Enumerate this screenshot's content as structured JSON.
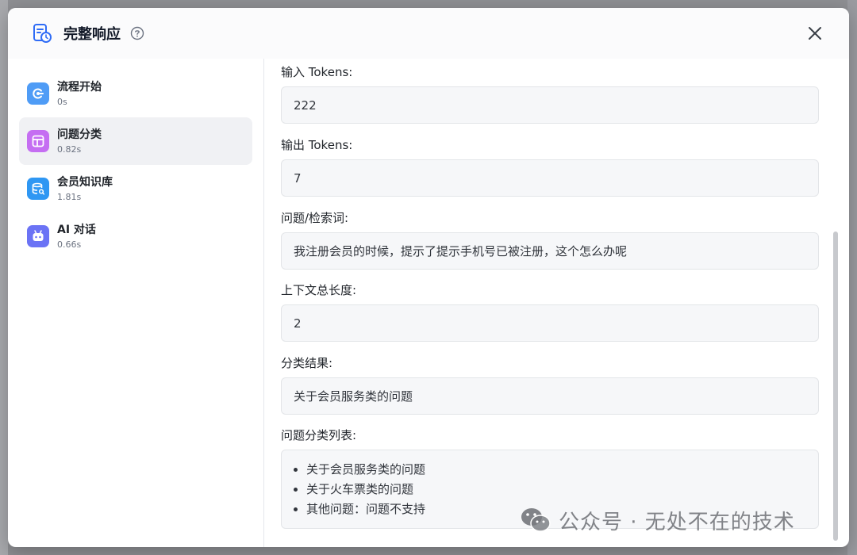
{
  "modal": {
    "title": "完整响应",
    "help_icon": "question-circle-icon",
    "close_icon": "close-icon",
    "header_icon": "log-clock-icon"
  },
  "steps": [
    {
      "name": "流程开始",
      "time": "0s",
      "icon": "flow-start-icon",
      "color": "#4f9cf6",
      "active": false
    },
    {
      "name": "问题分类",
      "time": "0.82s",
      "icon": "classify-layout-icon",
      "color": "#c56ef2",
      "active": true
    },
    {
      "name": "会员知识库",
      "time": "1.81s",
      "icon": "database-search-icon",
      "color": "#2f97f3",
      "active": false
    },
    {
      "name": "AI 对话",
      "time": "0.66s",
      "icon": "ai-robot-icon",
      "color": "#6b73f5",
      "active": false
    }
  ],
  "fields": {
    "input_tokens": {
      "label": "输入 Tokens:",
      "value": "222"
    },
    "output_tokens": {
      "label": "输出 Tokens:",
      "value": "7"
    },
    "query": {
      "label": "问题/检索词:",
      "value": "我注册会员的时候，提示了提示手机号已被注册，这个怎么办呢"
    },
    "context_length": {
      "label": "上下文总长度:",
      "value": "2"
    },
    "result": {
      "label": "分类结果:",
      "value": "关于会员服务类的问题"
    },
    "class_list": {
      "label": "问题分类列表:",
      "items": [
        "关于会员服务类的问题",
        "关于火车票类的问题",
        "其他问题：问题不支持"
      ]
    }
  },
  "watermark": {
    "text": "公众号 · 无处不在的技术",
    "icon": "wechat-icon"
  }
}
